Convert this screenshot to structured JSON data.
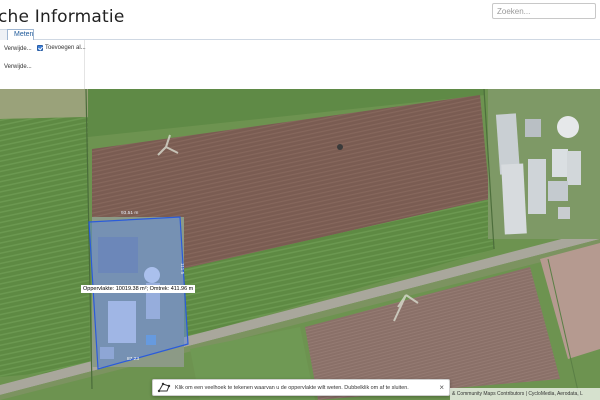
{
  "header": {
    "title": "che Informatie",
    "search_placeholder": "Zoeken..."
  },
  "tabs": [
    {
      "label": "",
      "active": false
    },
    {
      "label": "Meten",
      "active": true
    }
  ],
  "panel": {
    "remove_link_1": "Verwijde...",
    "add_checkbox_label": "Toevoegen al...",
    "add_checkbox_checked": true,
    "remove_link_2": "Verwijde..."
  },
  "map": {
    "measurement_label": "Oppervlakte: 10019.38 m²; Omtrek: 411.96 m",
    "side_top": "93.51 m",
    "side_right": "111.5",
    "side_bottom": "87.23",
    "hint_text": "Klik om een veelhoek te tekenen waarvan u de oppervlakte wilt weten. Dubbelklik om af te sluiten.",
    "hint_close": "×",
    "attribution": "& Community Maps Contributors | CycloMedia, Aerodata, L",
    "polygon_color": "#2a5bdb"
  }
}
